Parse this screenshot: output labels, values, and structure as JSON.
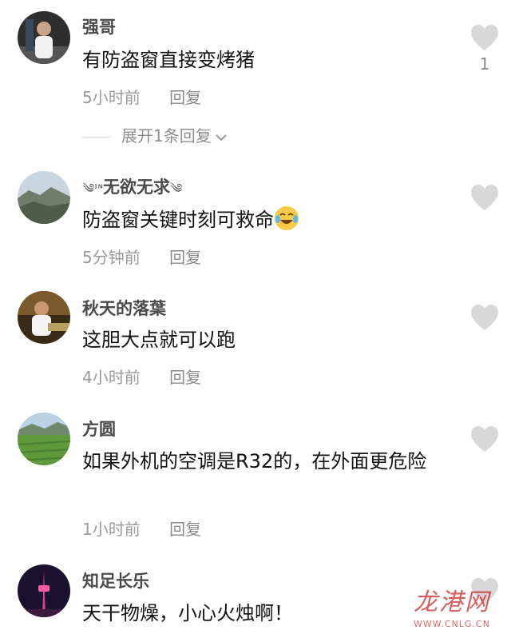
{
  "comments": [
    {
      "username": "强哥",
      "content": "有防盗窗直接变烤猪",
      "time": "5小时前",
      "reply": "回复",
      "likes": "1",
      "expand": "展开1条回复"
    },
    {
      "username": "无欲无求",
      "content": "防盗窗关键时刻可救命",
      "emoji": "crying-laughing-emoji",
      "time": "5分钟前",
      "reply": "回复"
    },
    {
      "username": "秋天的落葉",
      "content": "这胆大点就可以跑",
      "time": "4小时前",
      "reply": "回复"
    },
    {
      "username": "方圆",
      "content": "如果外机的空调是R32的，在外面更危险",
      "time": "1小时前",
      "reply": "回复"
    },
    {
      "username": "知足长乐",
      "content": "天干物燥，小心火烛啊！"
    }
  ],
  "watermark": {
    "logo": "龙港网",
    "url": "WWW.CNLG.CN"
  },
  "colors": {
    "heart": "#d8d8d8",
    "watermark": "#c62828"
  }
}
